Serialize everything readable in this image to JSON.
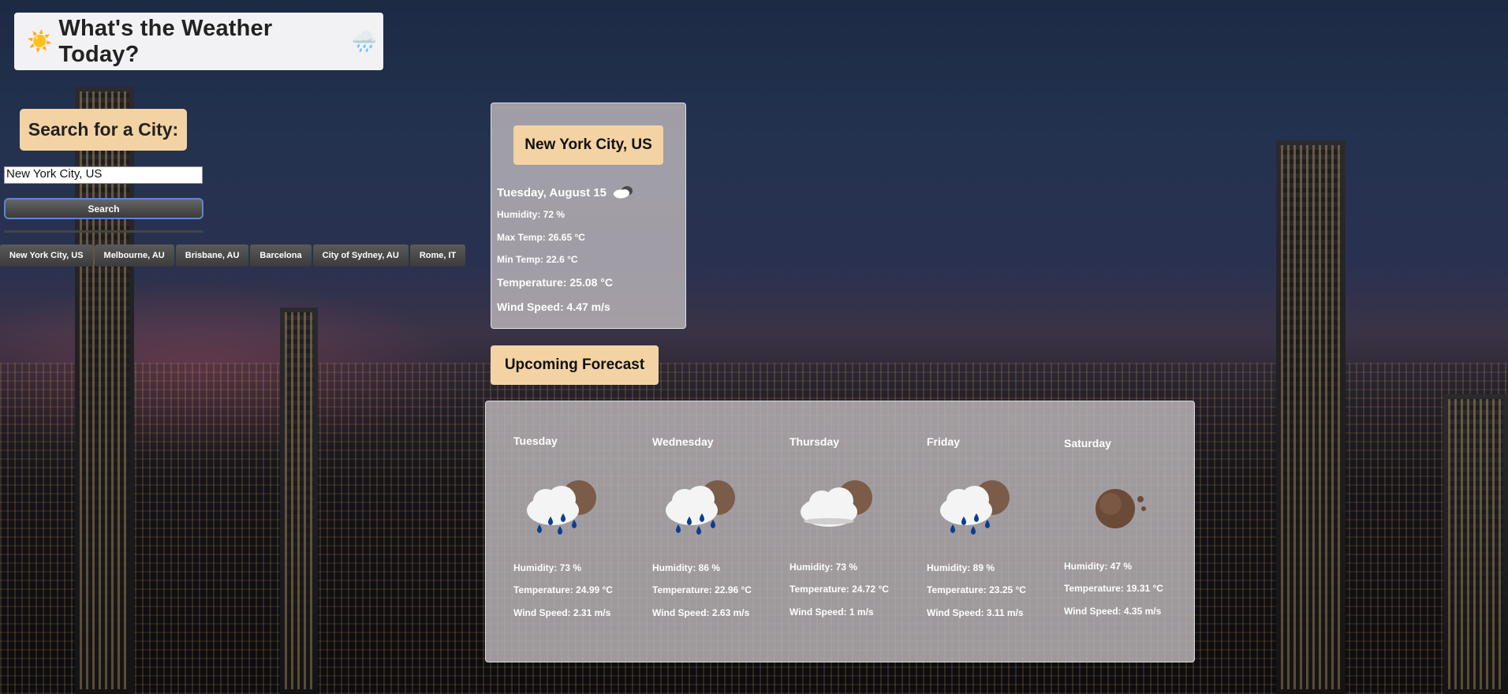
{
  "header": {
    "title": "What's the Weather Today?"
  },
  "search": {
    "label": "Search for a City:",
    "input_value": "New York City, US",
    "button_label": "Search"
  },
  "history": [
    "New York City, US",
    "Melbourne, AU",
    "Brisbane, AU",
    "Barcelona",
    "City of Sydney, AU",
    "Rome, IT"
  ],
  "current": {
    "city": "New York City, US",
    "date": "Tuesday, August 15",
    "humidity": "Humidity: 72 %",
    "max_temp": "Max Temp: 26.65 °C",
    "min_temp": "Min Temp: 22.6 °C",
    "temperature": "Temperature: 25.08 °C",
    "wind": "Wind Speed: 4.47 m/s",
    "icon": "cloudy-icon"
  },
  "forecast": {
    "title": "Upcoming Forecast",
    "days": [
      {
        "name": "Tuesday",
        "humidity": "Humidity: 73 %",
        "temperature": "Temperature: 24.99 °C",
        "wind": "Wind Speed: 2.31 m/s",
        "icon": "rain-icon"
      },
      {
        "name": "Wednesday",
        "humidity": "Humidity: 86 %",
        "temperature": "Temperature: 22.96 °C",
        "wind": "Wind Speed: 2.63 m/s",
        "icon": "rain-icon"
      },
      {
        "name": "Thursday",
        "humidity": "Humidity: 73 %",
        "temperature": "Temperature: 24.72 °C",
        "wind": "Wind Speed: 1 m/s",
        "icon": "cloudy-icon"
      },
      {
        "name": "Friday",
        "humidity": "Humidity: 89 %",
        "temperature": "Temperature: 23.25 °C",
        "wind": "Wind Speed: 3.11 m/s",
        "icon": "rain-icon"
      },
      {
        "name": "Saturday",
        "humidity": "Humidity: 47 %",
        "temperature": "Temperature: 19.31 °C",
        "wind": "Wind Speed: 4.35 m/s",
        "icon": "clear-night-icon"
      }
    ]
  }
}
